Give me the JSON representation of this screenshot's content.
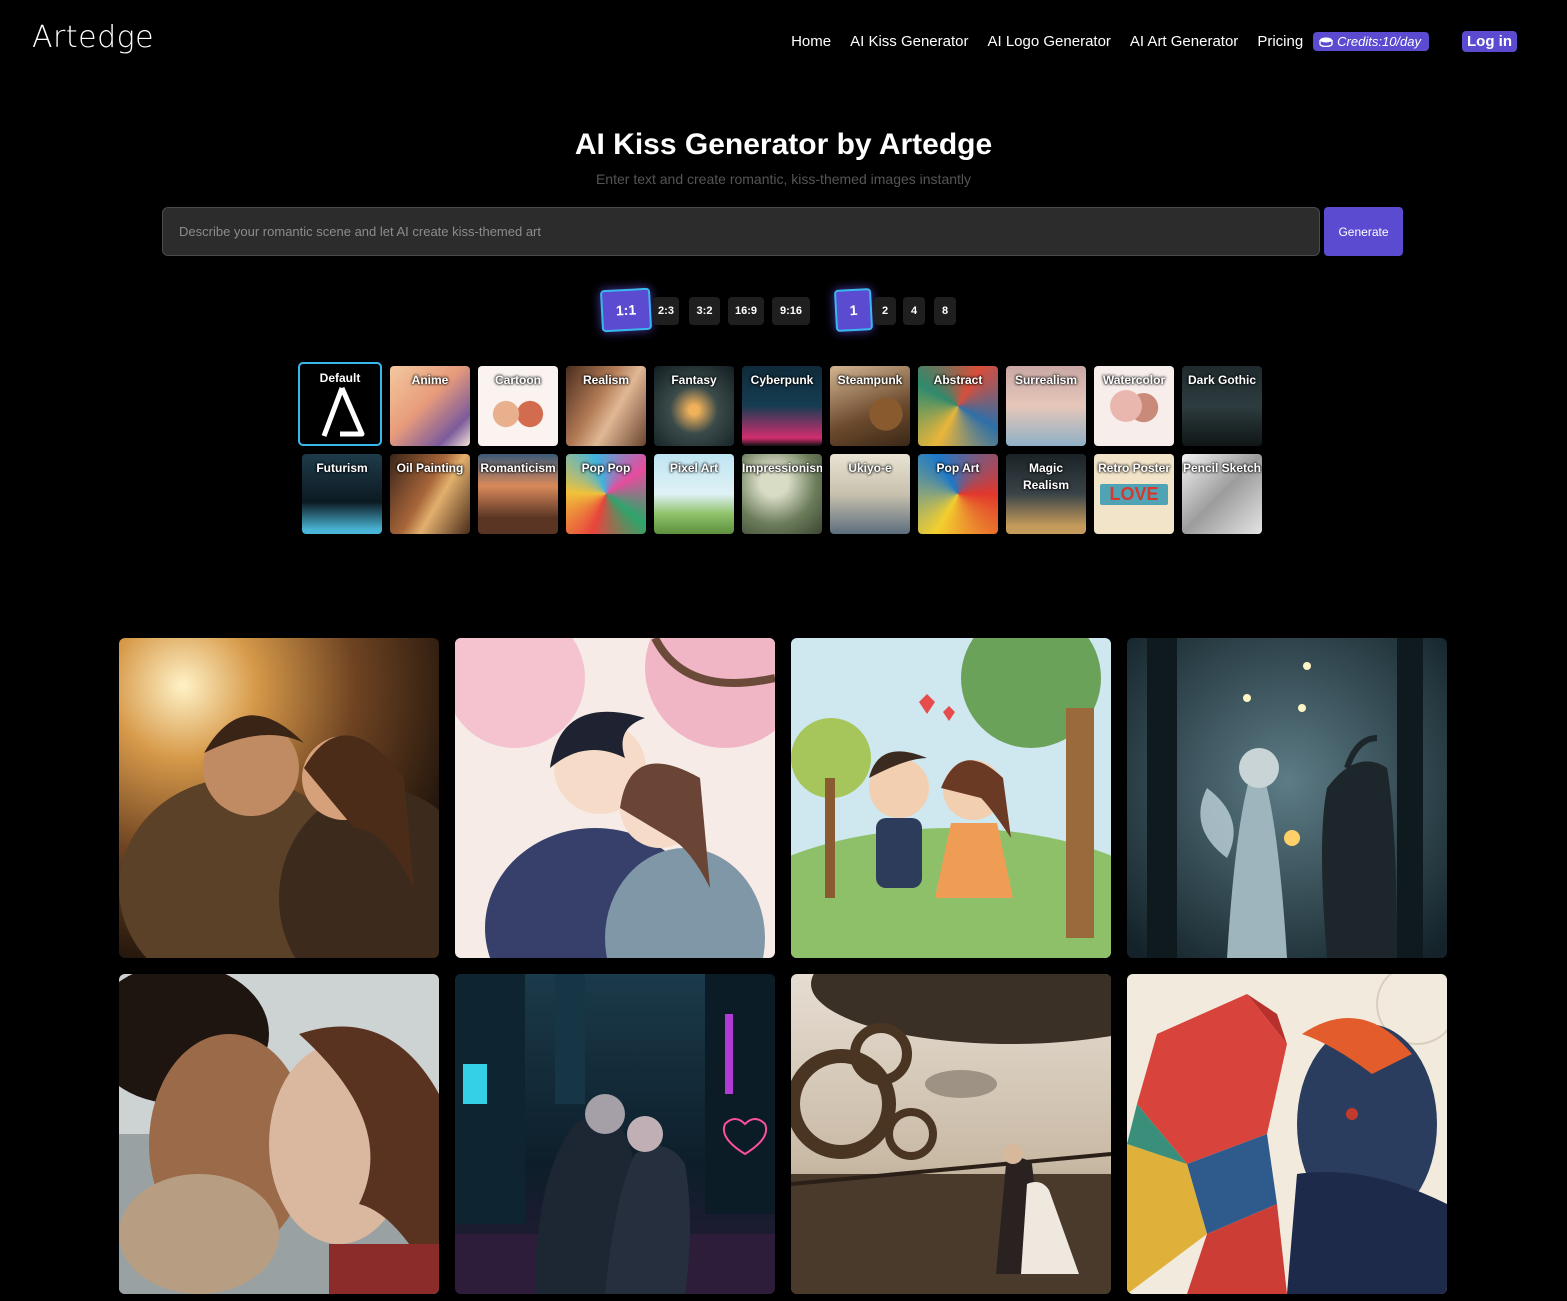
{
  "header": {
    "logo": "Artedge",
    "nav": [
      "Home",
      "AI Kiss Generator",
      "AI Logo Generator",
      "AI Art Generator",
      "Pricing"
    ],
    "credits": "Credits:10/day",
    "login": "Log in"
  },
  "hero": {
    "title": "AI Kiss Generator by Artedge",
    "subtitle": "Enter text and create romantic, kiss-themed images instantly",
    "placeholder": "Describe your romantic scene and let AI create kiss-themed art",
    "generate": "Generate"
  },
  "ratios": [
    "1:1",
    "2:3",
    "3:2",
    "16:9",
    "9:16"
  ],
  "selected_ratio": "1:1",
  "counts": [
    "1",
    "2",
    "4",
    "8"
  ],
  "selected_count": "1",
  "styles_row1": [
    "Default",
    "Anime",
    "Cartoon",
    "Realism",
    "Fantasy",
    "Cyberpunk",
    "Steampunk",
    "Abstract",
    "Surrealism",
    "Watercolor",
    "Dark Gothic"
  ],
  "styles_row2": [
    "Futurism",
    "Oil Painting",
    "Romanticism",
    "Pop Pop",
    "Pixel Art",
    "Impressionism",
    "Ukiyo-e",
    "Pop Art",
    "Magic Realism",
    "Retro Poster",
    "Pencil Sketch"
  ],
  "retro_poster_word": "LOVE",
  "selected_style": "Default",
  "gallery": [
    "realism-couple-sunset",
    "anime-couple-cherry-blossom",
    "cartoon-couple-park",
    "fantasy-fairy-dragon",
    "realism-couple-closeup",
    "cyberpunk-couple-city",
    "steampunk-couple-airship",
    "abstract-couple-geometric"
  ],
  "colors": {
    "accent": "#5a4bd1",
    "highlight": "#38b9ee",
    "background": "#000000"
  }
}
